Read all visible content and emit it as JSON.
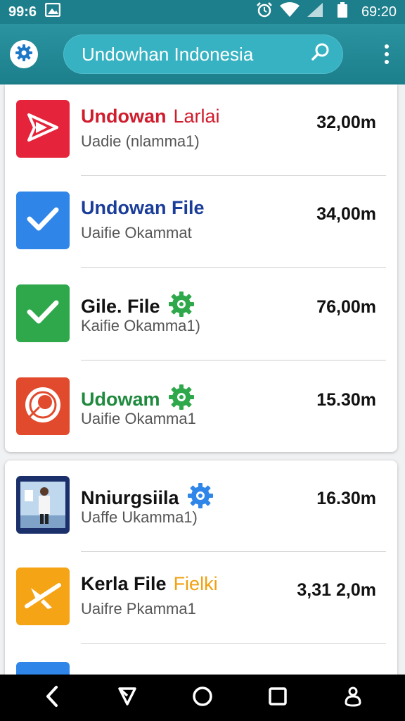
{
  "status": {
    "time_left": "99:6",
    "time_right": "69:20",
    "icons": [
      "image-icon",
      "alarm-icon",
      "wifi-icon",
      "signal-icon",
      "battery-icon"
    ]
  },
  "appbar": {
    "search_text": "Undowhan Indonesia",
    "icons": [
      "settings-icon",
      "search-icon",
      "more-icon"
    ]
  },
  "items": [
    {
      "title": "Undowan",
      "title_extra": "Larlai",
      "subtitle": "Uadie (nlamma1)",
      "size": "32,00m",
      "icon": "play-icon",
      "color": "#e5243b",
      "title_color": "#d01c2c",
      "extra_color": "#d01c2c",
      "badge": ""
    },
    {
      "title": "Undowan File",
      "title_extra": "",
      "subtitle": "Uaifie Okammat",
      "size": "34,00m",
      "icon": "check-icon",
      "color": "#2f86e8",
      "title_color": "#1a3d9a",
      "badge": ""
    },
    {
      "title": "Gile. File",
      "title_extra": "",
      "subtitle": "Kaifie Okamma1)",
      "size": "76,00m",
      "icon": "check-icon",
      "color": "#2ea84a",
      "title_color": "#111111",
      "badge": "gear-badge-icon",
      "badge_color": "#2ea84a"
    },
    {
      "title": "Udowam",
      "title_extra": "",
      "subtitle": "Uaifie Okamma1",
      "size": "15.30m",
      "icon": "target-icon",
      "color": "#e14a2c",
      "title_color": "#1f8a3e",
      "badge": "gear-badge-icon",
      "badge_color": "#2ea84a"
    },
    {
      "title": "Nniurgsiila",
      "title_extra": "",
      "subtitle": "Uaffe Ukamma1)",
      "size": "16.30m",
      "icon": "photo-thumbnail",
      "color": "#1b2f6b",
      "title_color": "#111111",
      "badge": "gear-badge-icon",
      "badge_color": "#2f86e8"
    },
    {
      "title": "Kerla File",
      "title_extra": "Fielki",
      "subtitle": "Uaifre Pkamma1",
      "size": "3,31 2,0m",
      "icon": "plane-icon",
      "color": "#f4a415",
      "title_color": "#111111",
      "extra_color": "#f0a010",
      "badge": ""
    }
  ],
  "navbar": {
    "icons": [
      "back-icon",
      "recent-apps-icon",
      "home-icon",
      "overview-icon",
      "accessibility-icon"
    ]
  }
}
